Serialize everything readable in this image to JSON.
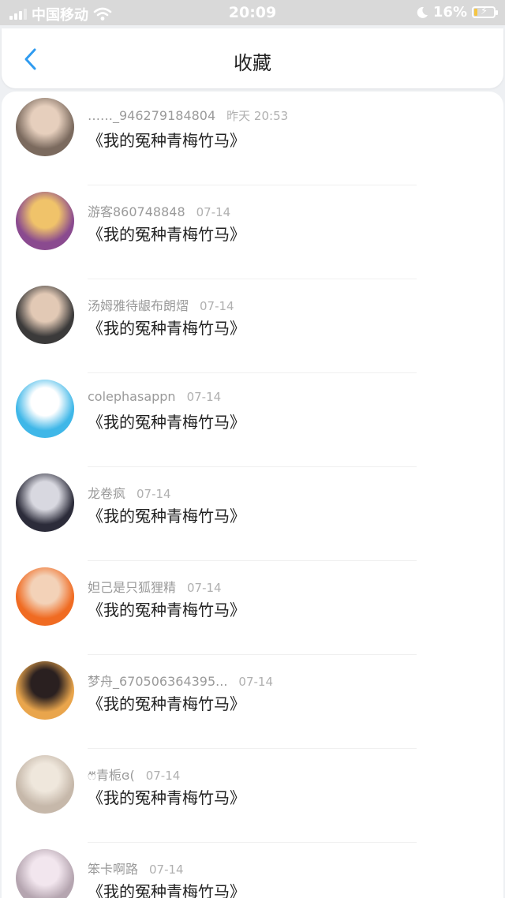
{
  "status_bar": {
    "carrier": "中国移动",
    "time": "20:09",
    "battery_percent": "16%",
    "battery_level": 0.16,
    "icons": [
      "signal-icon",
      "wifi-icon",
      "moon-icon",
      "battery-charging-icon"
    ]
  },
  "nav": {
    "back_icon": "chevron-left-icon",
    "title": "收藏",
    "accent_color": "#2f9bf0"
  },
  "favorites": [
    {
      "user": "……_946279184804",
      "time": "昨天 20:53",
      "content": "《我的冤种青梅竹马》",
      "avatar_colors": [
        "#7b6a5e",
        "#e6cfbd"
      ]
    },
    {
      "user": "游客860748848",
      "time": "07-14",
      "content": "《我的冤种青梅竹马》",
      "avatar_colors": [
        "#8a4a8f",
        "#f0c36a"
      ]
    },
    {
      "user": "汤姆雅待龈布朗熠",
      "time": "07-14",
      "content": "《我的冤种青梅竹马》",
      "avatar_colors": [
        "#3b3a3a",
        "#e2c9b5"
      ]
    },
    {
      "user": "colephasappn",
      "time": "07-14",
      "content": "《我的冤种青梅竹马》",
      "avatar_colors": [
        "#3fb7e8",
        "#ffffff"
      ]
    },
    {
      "user": "龙卷疯",
      "time": "07-14",
      "content": "《我的冤种青梅竹马》",
      "avatar_colors": [
        "#2c2c3a",
        "#d8d8e0"
      ]
    },
    {
      "user": "妲己是只狐狸精",
      "time": "07-14",
      "content": "《我的冤种青梅竹马》",
      "avatar_colors": [
        "#f06b22",
        "#f3d2b8"
      ]
    },
    {
      "user": "梦舟_670506364395...",
      "time": "07-14",
      "content": "《我的冤种青梅竹马》",
      "avatar_colors": [
        "#e9a54c",
        "#2a2020"
      ]
    },
    {
      "user": "ෆ⃛青栀ɞ(",
      "time": "07-14",
      "content": "《我的冤种青梅竹马》",
      "avatar_colors": [
        "#c6b8aa",
        "#efe7dc"
      ]
    },
    {
      "user": "笨卡啊路",
      "time": "07-14",
      "content": "《我的冤种青梅竹马》",
      "avatar_colors": [
        "#b5a5b0",
        "#f2e6ee"
      ]
    }
  ]
}
